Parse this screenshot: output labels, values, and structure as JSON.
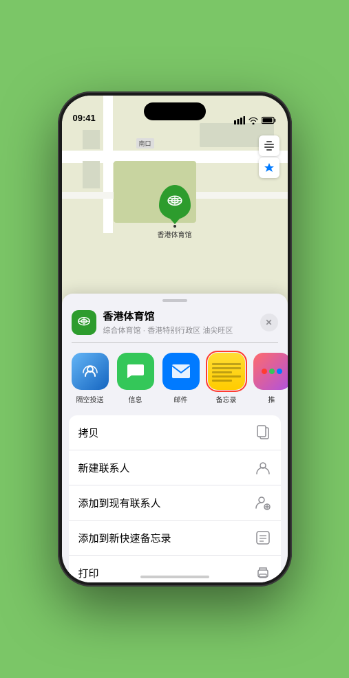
{
  "status_bar": {
    "time": "09:41",
    "signal_icon": "signal-bars",
    "wifi_icon": "wifi",
    "battery_icon": "battery"
  },
  "map": {
    "label_nankou": "南口",
    "marker_label": "香港体育馆",
    "controls": [
      {
        "icon": "map-layers",
        "label": "地图图层"
      },
      {
        "icon": "location-arrow",
        "label": "定位"
      }
    ]
  },
  "location_card": {
    "name": "香港体育馆",
    "subtitle": "综合体育馆 · 香港特别行政区 油尖旺区",
    "close_label": "✕"
  },
  "share_items": [
    {
      "id": "airdrop",
      "label": "隔空投送",
      "type": "airdrop"
    },
    {
      "id": "messages",
      "label": "信息",
      "type": "messages"
    },
    {
      "id": "mail",
      "label": "邮件",
      "type": "mail"
    },
    {
      "id": "notes",
      "label": "备忘录",
      "type": "notes",
      "selected": true
    },
    {
      "id": "more",
      "label": "推",
      "type": "more"
    }
  ],
  "actions": [
    {
      "id": "copy",
      "label": "拷贝",
      "icon": "copy"
    },
    {
      "id": "new-contact",
      "label": "新建联系人",
      "icon": "person-add"
    },
    {
      "id": "add-existing",
      "label": "添加到现有联系人",
      "icon": "person-circle-add"
    },
    {
      "id": "add-note",
      "label": "添加到新快速备忘录",
      "icon": "note-add"
    },
    {
      "id": "print",
      "label": "打印",
      "icon": "printer"
    }
  ]
}
